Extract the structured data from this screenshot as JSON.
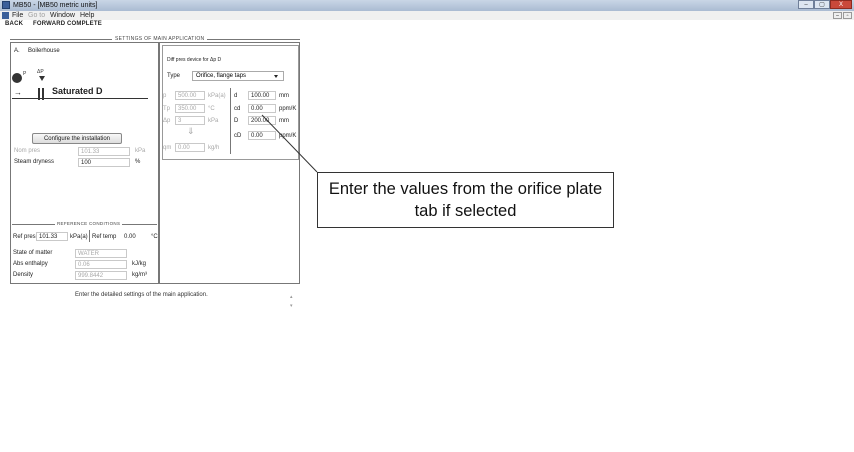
{
  "window": {
    "title": "MB50 - [MB50 metric units]",
    "min_label": "–",
    "max_label": "▢",
    "close_label": "X"
  },
  "menu": {
    "file": "File",
    "goto": "Go to",
    "window": "Window",
    "help": "Help"
  },
  "nav": {
    "back": "BACK",
    "forward": "FORWARD",
    "complete": "COMPLETE"
  },
  "section_title": "SETTINGS OF MAIN APPLICATION",
  "left": {
    "item_letter": "A.",
    "item_value": "Boilerhouse",
    "diagram_label": "Saturated D",
    "pump_sup": "P",
    "delta_p": "ΔP",
    "configure_button": "Configure the installation",
    "nom_pres_label": "Nom pres",
    "nom_pres_value": "101.33",
    "nom_pres_unit": "kPa",
    "steam_dryness_label": "Steam dryness",
    "steam_dryness_value": "100",
    "steam_dryness_unit": "%",
    "reference_title": "REFERENCE CONDITIONS",
    "ref_pres_label": "Ref pres",
    "ref_pres_value": "101.33",
    "ref_pres_unit": "kPa(a)",
    "ref_temp_label": "Ref temp",
    "ref_temp_value": "0.00",
    "ref_temp_unit": "°C",
    "state_label": "State of matter",
    "state_value": "WATER",
    "abs_enthalpy_label": "Abs enthalpy",
    "abs_enthalpy_value": "0.06",
    "abs_enthalpy_unit": "kJ/kg",
    "density_label": "Density",
    "density_value": "999.8442",
    "density_unit": "kg/m³"
  },
  "right": {
    "diff_pres_label": "Diff pres device for Δp D",
    "type_label": "Type",
    "type_value": "Orifice, flange taps",
    "pressure_label": "p",
    "pressure_value": "500.00",
    "pressure_unit": "kPa(a)",
    "temp_label": "Tp",
    "temp_value": "350.00",
    "temp_unit": "°C",
    "dp_label": "Δp",
    "dp_value": "3",
    "dp_unit": "kPa",
    "arrow": "⇓",
    "qm_label": "qm",
    "qm_value": "0.00",
    "qm_unit": "kg/h",
    "d_label": "d",
    "d_value": "100.00",
    "d_unit": "mm",
    "cd_label": "cd",
    "cd_value": "0.00",
    "cd_unit": "ppm/K",
    "D_label": "D",
    "D_value": "200.00",
    "D_unit": "mm",
    "cD_label": "cD",
    "cD_value": "0.00",
    "cD_unit": "ppm/K"
  },
  "status": {
    "text": "Enter the detailed settings of the main application."
  },
  "annotation": {
    "text": "Enter the values from the orifice plate tab if selected"
  }
}
